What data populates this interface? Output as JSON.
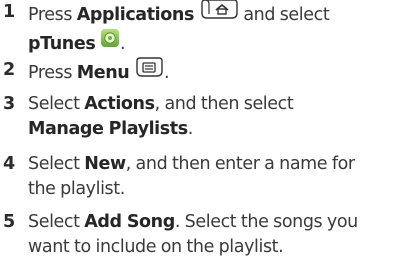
{
  "steps": [
    {
      "number": "1",
      "before": "Press ",
      "bold1": "Applications",
      "icon1": "applications-key-icon",
      "middle": " and select",
      "bold2": "pTunes",
      "icon2": "ptunes-app-icon",
      "after": "."
    },
    {
      "number": "2",
      "before": "Press ",
      "bold1": "Menu",
      "icon1": "menu-key-icon",
      "after": "."
    },
    {
      "number": "3",
      "before": "Select ",
      "bold1": "Actions",
      "middle": ", and then select",
      "bold2": "Manage Playlists",
      "after": "."
    },
    {
      "number": "4",
      "before": "Select ",
      "bold1": "New",
      "middle": ", and then enter a name for",
      "line2": "the playlist."
    },
    {
      "number": "5",
      "before": "Select ",
      "bold1": "Add Song",
      "middle": ". Select the songs you",
      "line2": "want to include on the playlist."
    }
  ],
  "colors": {
    "text": "#3a3a3a",
    "ptunes_icon": "#7cc242"
  }
}
